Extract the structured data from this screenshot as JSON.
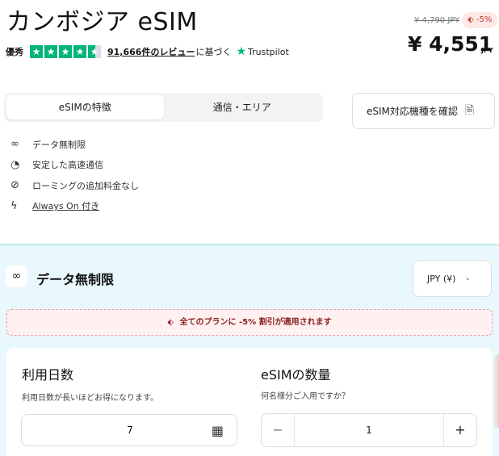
{
  "product": {
    "title": "カンボジア eSIM",
    "rating_label": "優秀",
    "stars": 4.5,
    "reviews_link": "91,666件のレビュー",
    "reviews_suffix": "に基づく",
    "trustpilot": "Trustpilot"
  },
  "price": {
    "old": "¥ 4,790 JPY",
    "discount": "-5%",
    "current": "¥ 4,551",
    "currency": "JPY"
  },
  "tabs": [
    {
      "label": "eSIMの特徴",
      "active": true
    },
    {
      "label": "通信・エリア",
      "active": false
    }
  ],
  "compat_button": "eSIM対応機種を確認",
  "features": [
    {
      "icon": "infinity-icon",
      "label": "データ無制限"
    },
    {
      "icon": "speedometer-icon",
      "label": "安定した高速通信"
    },
    {
      "icon": "no-roaming-icon",
      "label": "ローミングの追加料金なし"
    },
    {
      "icon": "lightning-icon",
      "label": "Always On 付き"
    }
  ],
  "plan": {
    "title": "データ無制限",
    "currency_select": "JPY (¥)",
    "notice": "全てのプランに -5% 割引が適用されます",
    "days": {
      "title": "利用日数",
      "subtitle": "利用日数が長いほどお得になります。",
      "value": "7"
    },
    "quantity": {
      "title": "eSIMの数量",
      "subtitle": "何名様分ご入用ですか？",
      "value": "1",
      "minus": "−",
      "plus": "+"
    }
  },
  "colors": {
    "trustpilot_green": "#00b67a",
    "discount_red": "#c0392b",
    "section_bg": "#e8f8fd"
  }
}
